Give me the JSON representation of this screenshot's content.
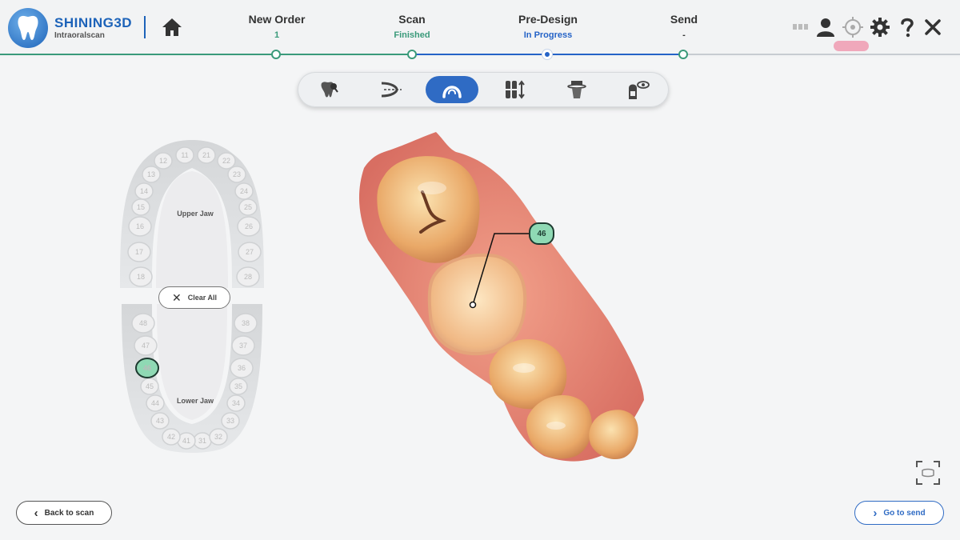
{
  "app": {
    "brand": "SHINING3D",
    "subtitle": "Intraoralscan"
  },
  "header": {
    "steps": [
      {
        "name": "New Order",
        "status": "1",
        "status_color": "#3a9a7a"
      },
      {
        "name": "Scan",
        "status": "Finished",
        "status_color": "#3a9a7a"
      },
      {
        "name": "Pre-Design",
        "status": "In Progress",
        "status_color": "#2563c7"
      },
      {
        "name": "Send",
        "status": "-",
        "status_color": "#333333"
      }
    ],
    "icons": [
      "battery-icon",
      "user-icon",
      "target-icon",
      "settings-icon",
      "help-icon",
      "close-icon"
    ]
  },
  "toolbar": {
    "tools": [
      "tooth-select-icon",
      "margin-line-icon",
      "arch-icon",
      "spacing-icon",
      "abutment-icon",
      "view-icon"
    ],
    "active_index": 2
  },
  "jaw_chart": {
    "upper_label": "Upper Jaw",
    "lower_label": "Lower Jaw",
    "clear_all": "Clear All",
    "upper_teeth": [
      "11",
      "12",
      "13",
      "14",
      "15",
      "16",
      "17",
      "18",
      "21",
      "22",
      "23",
      "24",
      "25",
      "26",
      "27",
      "28"
    ],
    "lower_teeth": [
      "31",
      "32",
      "33",
      "34",
      "35",
      "36",
      "37",
      "38",
      "41",
      "42",
      "43",
      "44",
      "45",
      "46",
      "47",
      "48"
    ],
    "selected_tooth": "46"
  },
  "model": {
    "callout_tooth": "46"
  },
  "footer": {
    "back_label": "Back to scan",
    "send_label": "Go to send"
  },
  "colors": {
    "brand_blue": "#1d63b9",
    "active_blue": "#2f6bc4",
    "done_green": "#3a9a7a",
    "selected_tooth": "#8fd9b4",
    "gum_pink": "#e8826f"
  }
}
